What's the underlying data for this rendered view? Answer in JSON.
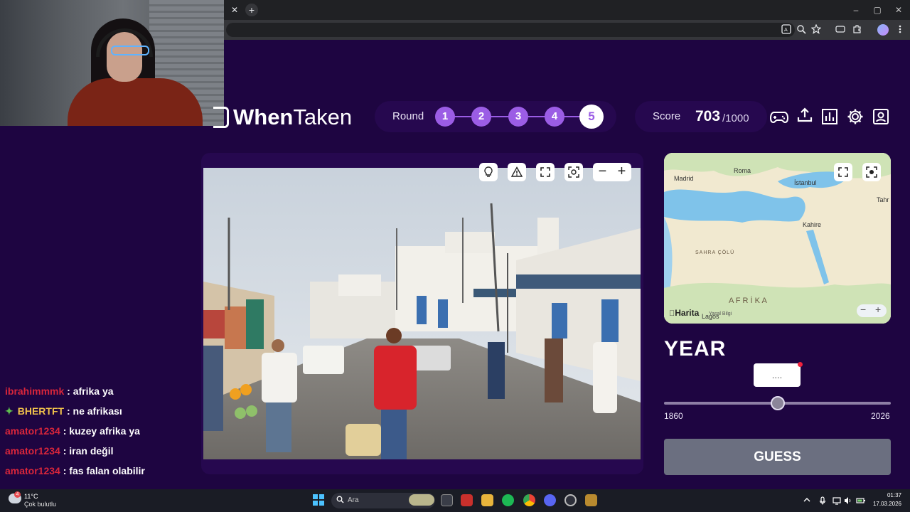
{
  "browser": {
    "tab_close": "✕",
    "new_tab": "+",
    "window_controls": {
      "minimize": "–",
      "maximize": "▢",
      "close": "✕"
    },
    "toolbar_icons": [
      "translate-icon",
      "zoom-icon",
      "star-icon",
      "reading-icon",
      "extensions-icon",
      "profile-icon",
      "menu-icon"
    ]
  },
  "game": {
    "logo_bold": "When",
    "logo_regular": "Taken",
    "round": {
      "label": "Round",
      "steps": [
        "1",
        "2",
        "3",
        "4",
        "5"
      ],
      "current": "5"
    },
    "score": {
      "label": "Score",
      "value": "703",
      "total": "/1000"
    },
    "header_icons": [
      "gamepad-icon",
      "share-icon",
      "stats-icon",
      "settings-icon",
      "profile-icon"
    ],
    "photo_tools": [
      "hint-icon",
      "report-icon",
      "fullscreen-icon",
      "focus-icon"
    ],
    "zoom": {
      "minus": "−",
      "plus": "+"
    }
  },
  "map": {
    "labels": {
      "madrid": "Madrid",
      "roma": "Roma",
      "istanbul": "İstanbul",
      "tahran": "Tahr",
      "kahire": "Kahire",
      "sahra": "SAHRA ÇÖLÜ",
      "afrika": "A F R İ K A",
      "lagos": "Lagos"
    },
    "attribution": "Harita",
    "legal": "Yasal Bilgi",
    "zoom_minus": "−",
    "zoom_plus": "+"
  },
  "year": {
    "title": "YEAR",
    "input_value": "....",
    "min": "1860",
    "max": "2026",
    "slider_fraction": 0.5,
    "guess_label": "GUESS"
  },
  "chat": [
    {
      "user": "ibrahimmmk",
      "sep": " : ",
      "text": "afrika ya",
      "badge": ""
    },
    {
      "user": "BHERTFT",
      "sep": " : ",
      "text": "ne afrikası",
      "badge": "✦"
    },
    {
      "user": "amator1234",
      "sep": " : ",
      "text": "kuzey afrika ya",
      "badge": ""
    },
    {
      "user": "amator1234",
      "sep": " : ",
      "text": "iran değil",
      "badge": ""
    },
    {
      "user": "amator1234",
      "sep": " : ",
      "text": "fas falan olabilir",
      "badge": ""
    }
  ],
  "taskbar": {
    "weather_badge": "4",
    "temp": "11°C",
    "weather": "Çok bulutlu",
    "search_placeholder": "Ara",
    "time": "01:37",
    "date": "17.03.2026"
  },
  "colors": {
    "background": "#1e0541",
    "panel": "#26084f",
    "accent": "#9b5de5",
    "chat_user": "#d9263b",
    "guess_button": "#6b6f80"
  }
}
